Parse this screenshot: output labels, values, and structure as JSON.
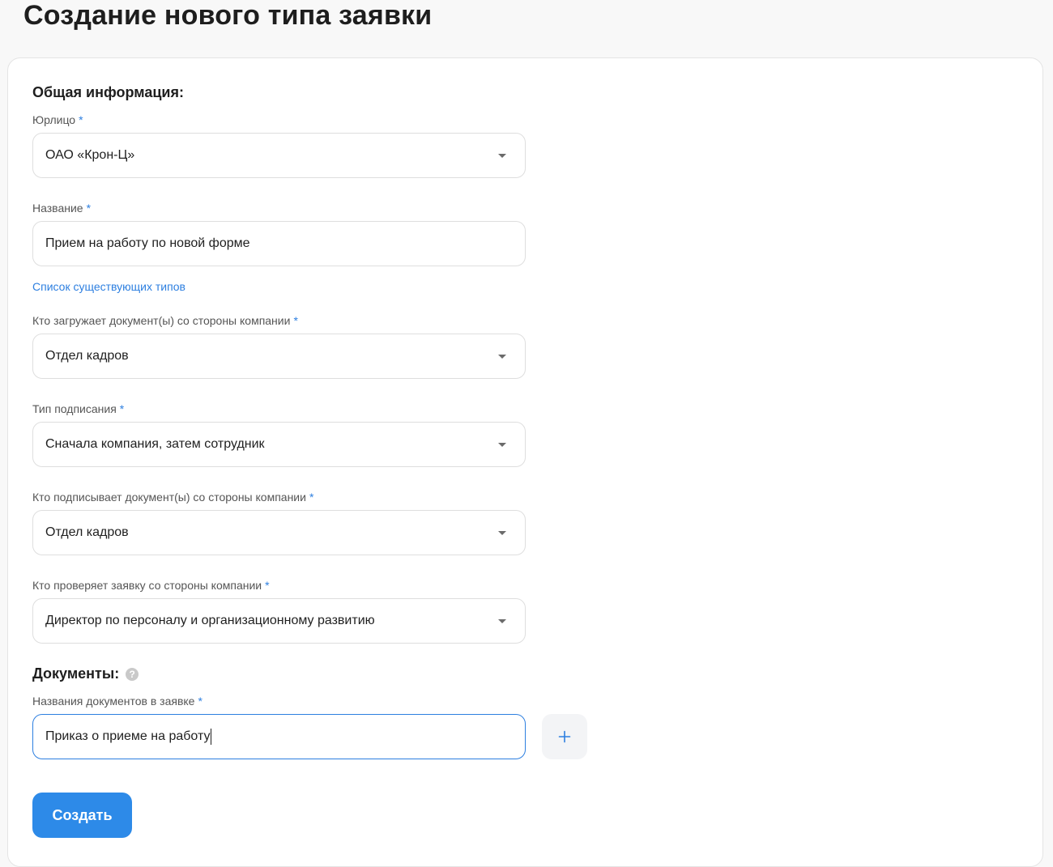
{
  "page": {
    "title": "Создание нового типа заявки"
  },
  "general_section": {
    "title": "Общая информация:"
  },
  "fields": {
    "legal_entity": {
      "label": "Юрлицо",
      "required_mark": "*",
      "value": "ОАО «Крон-Ц»"
    },
    "name": {
      "label": "Название",
      "required_mark": "*",
      "value": "Прием на работу по новой форме"
    },
    "existing_types_link": "Список существующих типов",
    "uploader": {
      "label": "Кто загружает документ(ы) со стороны компании",
      "required_mark": "*",
      "value": "Отдел кадров"
    },
    "signing_type": {
      "label": "Тип подписания",
      "required_mark": "*",
      "value": "Сначала компания, затем сотрудник"
    },
    "signer": {
      "label": "Кто подписывает документ(ы) со стороны компании",
      "required_mark": "*",
      "value": "Отдел кадров"
    },
    "reviewer": {
      "label": "Кто проверяет заявку со стороны компании",
      "required_mark": "*",
      "value": "Директор по персоналу и организационному развитию"
    }
  },
  "documents_section": {
    "title": "Документы:",
    "help_glyph": "?",
    "doc_names": {
      "label": "Названия документов в заявке",
      "required_mark": "*",
      "value": "Приказ о приеме на работу"
    }
  },
  "actions": {
    "submit_label": "Создать"
  },
  "colors": {
    "accent": "#2d8ae8",
    "link": "#2d7fe0",
    "border": "#dedede"
  },
  "icons": {
    "dropdown": "chevron-down-icon",
    "add": "plus-icon",
    "help": "question-circle-icon"
  }
}
